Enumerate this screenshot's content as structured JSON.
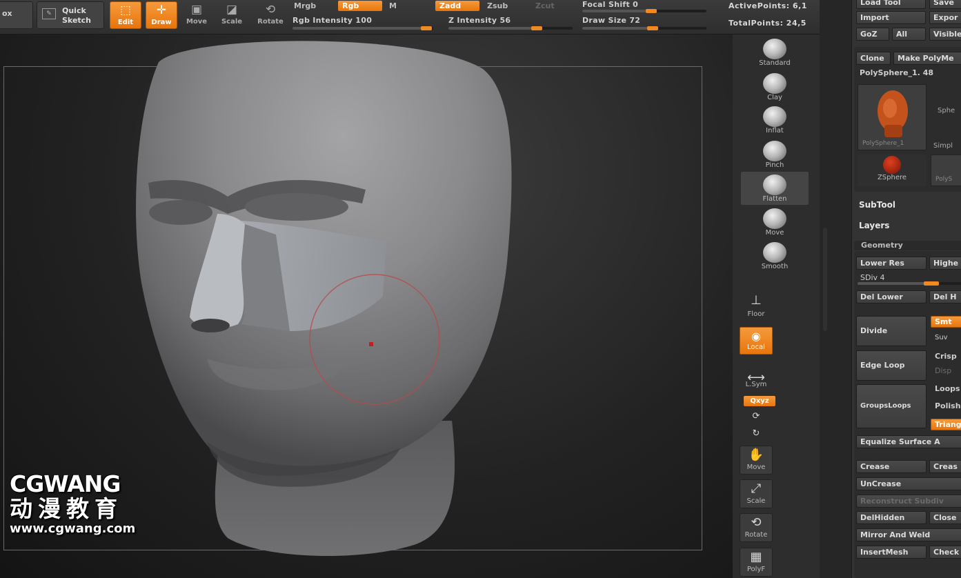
{
  "toolbar": {
    "edge_label": "ox",
    "quick_sketch": {
      "line1": "Quick",
      "line2": "Sketch"
    },
    "edit": "Edit",
    "draw": "Draw",
    "move": "Move",
    "scale": "Scale",
    "rotate": "Rotate",
    "mrgb": "Mrgb",
    "rgb": "Rgb",
    "m": "M",
    "rgb_intensity": "Rgb Intensity 100",
    "zadd": "Zadd",
    "zsub": "Zsub",
    "zcut": "Zcut",
    "z_intensity": "Z Intensity 56",
    "focal_shift": "Focal Shift 0",
    "draw_size": "Draw Size 72",
    "active_points": "ActivePoints: 6,1",
    "total_points": "TotalPoints: 24,5",
    "rgb_intensity_value": 100,
    "z_intensity_value": 56,
    "focal_shift_value": 0,
    "draw_size_value": 72
  },
  "shelf": {
    "brushes": [
      "Standard",
      "Clay",
      "Inflat",
      "Pinch",
      "Flatten",
      "Move",
      "Smooth"
    ],
    "selected_brush": "Flatten",
    "floor": "Floor",
    "local": "Local",
    "lsym": "L.Sym",
    "xyz": "Qxyz",
    "move": "Move",
    "scale": "Scale",
    "rotate": "Rotate",
    "polyf": "PolyF"
  },
  "panel": {
    "load_tool": "Load Tool",
    "save_as": "Save",
    "import": "Import",
    "export": "Expor",
    "goz": "GoZ",
    "all": "All",
    "visible": "Visible",
    "clone": "Clone",
    "make_polymesh": "Make PolyMe",
    "current_tool": "PolySphere_1. 48",
    "thumb_caption": "PolySphere_1",
    "sphere_label": "Sphe",
    "simple_label": "Simpl",
    "zsphere": "ZSphere",
    "polys_label": "PolyS",
    "subtool": "SubTool",
    "layers": "Layers",
    "geometry": "Geometry",
    "lower_res": "Lower Res",
    "higher": "Highe",
    "sdiv": "SDiv 4",
    "sdiv_value": 4,
    "del_lower": "Del Lower",
    "del_higher": "Del H",
    "divide": "Divide",
    "smt": "Smt",
    "suv": "Suv",
    "edge_loop": "Edge Loop",
    "crisp": "Crisp",
    "disp": "Disp",
    "grouploops": "GroupsLoops",
    "loops": "Loops",
    "polish": "Polish",
    "triangles": "Triang",
    "equalize": "Equalize Surface A",
    "crease": "Crease",
    "crease_lvl": "Creas",
    "uncrease": "UnCrease",
    "reconstruct": "Reconstruct Subdiv",
    "del_hidden": "DelHidden",
    "close_holes": "Close",
    "mirror_weld": "Mirror And Weld",
    "insert_mesh": "InsertMesh",
    "check_mesh": "Check"
  },
  "watermark": {
    "brand": "CGWANG",
    "chinese": "动漫教育",
    "url": "www.cgwang.com"
  },
  "colors": {
    "accent": "#f08a20",
    "panel_bg": "#333333",
    "viewport_bg": "#1a1a1a"
  }
}
